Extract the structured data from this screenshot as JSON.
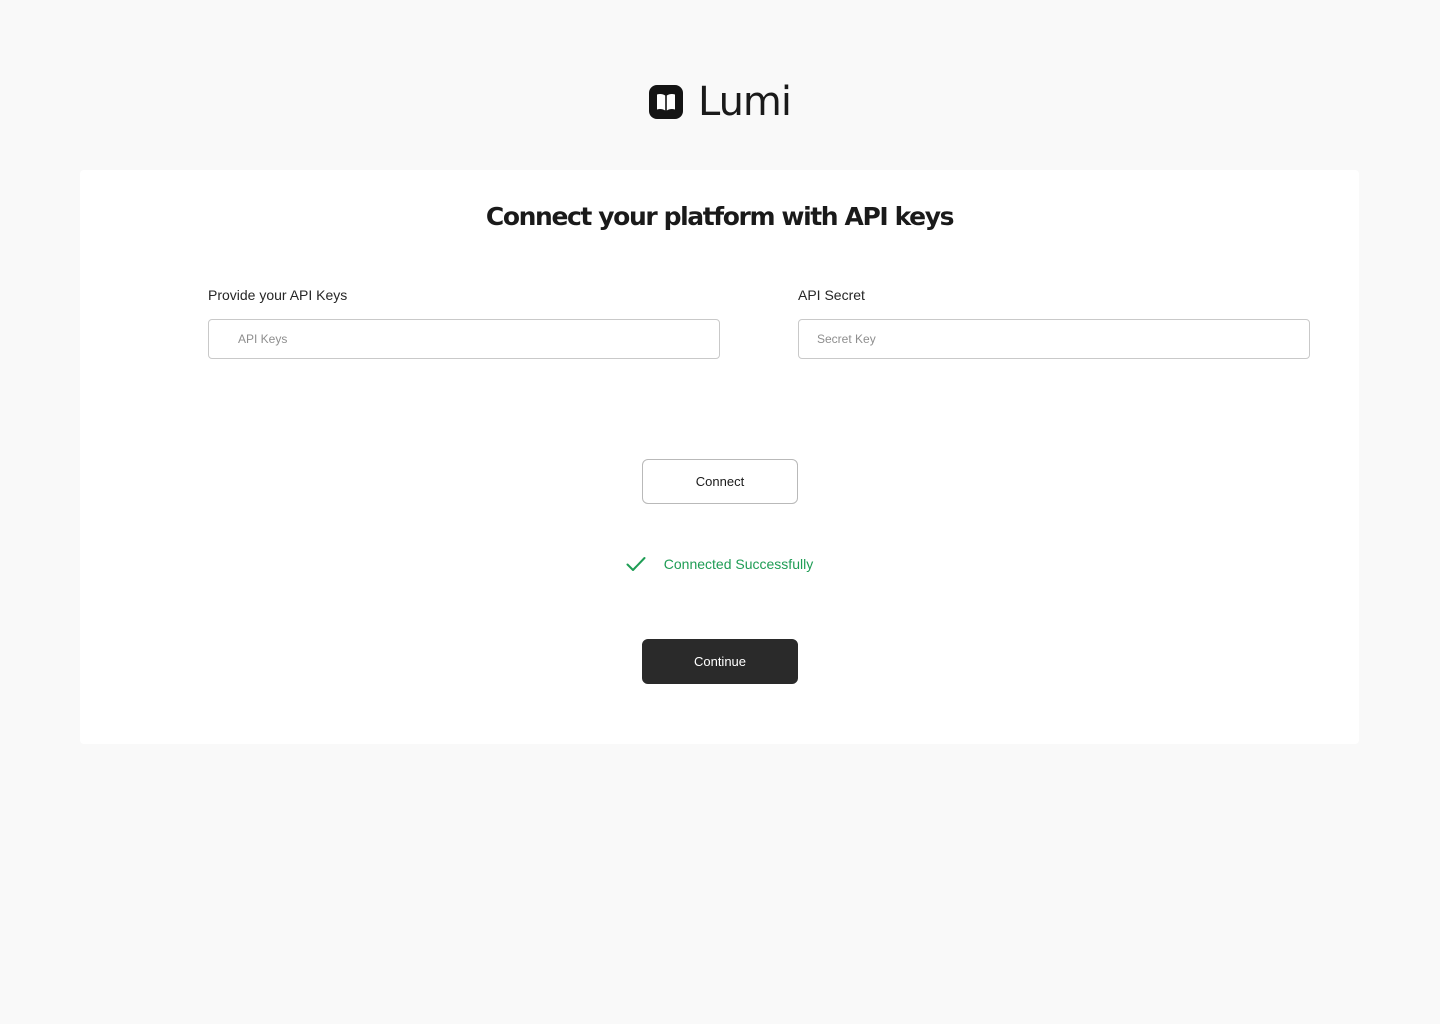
{
  "brand": {
    "name": "Lumi",
    "logo_icon": "book-icon"
  },
  "card": {
    "title": "Connect your platform with API keys"
  },
  "api_keys_field": {
    "label": "Provide your API Keys",
    "placeholder": "API Keys",
    "value": ""
  },
  "api_secret_field": {
    "label": "API Secret",
    "placeholder": "Secret Key",
    "value": ""
  },
  "connect_button": {
    "label": "Connect"
  },
  "status": {
    "icon": "check-icon",
    "text": "Connected Successfully",
    "color": "#1f9d55"
  },
  "continue_button": {
    "label": "Continue"
  },
  "colors": {
    "page_background": "#f9f9f9",
    "card_background": "#ffffff",
    "primary_button": "#2a2a2a",
    "success": "#1f9d55"
  }
}
